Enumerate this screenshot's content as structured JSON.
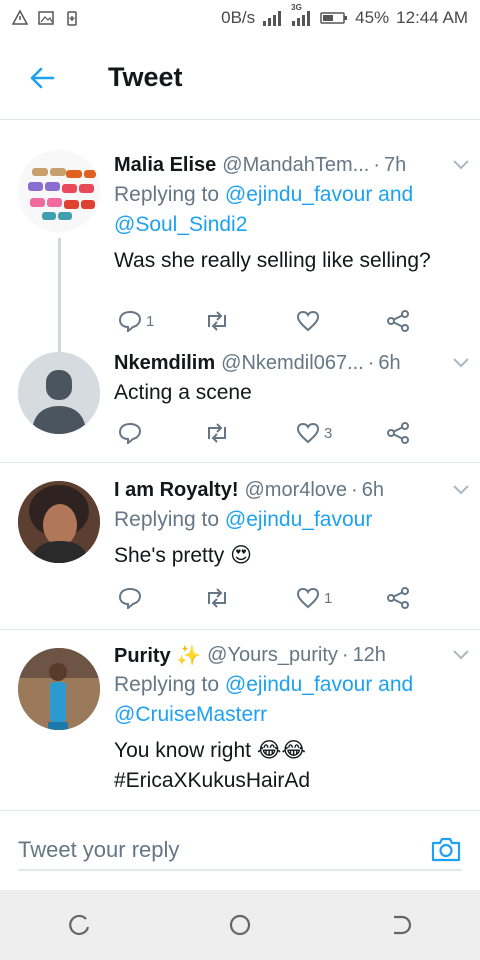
{
  "status_bar": {
    "network_speed": "0B/s",
    "network_type": "3G",
    "battery": "45%",
    "time": "12:44 AM"
  },
  "header": {
    "title": "Tweet",
    "back_icon": "arrow-left-icon"
  },
  "tweets": [
    {
      "name": "Malia Elise",
      "handle": "@MandahTem...",
      "time": "7h",
      "replying_prefix": "Replying to",
      "reply_to_1": "@ejindu_favour",
      "reply_joiner": "and",
      "reply_to_2": "@Soul_Sindi2",
      "text": "Was she really selling like selling?",
      "reply_count": "1",
      "like_count": ""
    },
    {
      "name": "Nkemdilim",
      "handle": "@Nkemdil067...",
      "time": "6h",
      "text": "Acting a scene",
      "reply_count": "",
      "like_count": "3"
    },
    {
      "name": "I am Royalty!",
      "handle": "@mor4love",
      "time": "6h",
      "replying_prefix": "Replying to",
      "reply_to_1": "@ejindu_favour",
      "text": "She's pretty 😍",
      "reply_count": "",
      "like_count": "1"
    },
    {
      "name": "Purity ✨",
      "handle": "@Yours_purity",
      "time": "12h",
      "replying_prefix": "Replying to",
      "reply_to_1": "@ejindu_favour",
      "reply_joiner": "and",
      "reply_to_2": "@CruiseMasterr",
      "text": "You know right 😂😂",
      "hashtag": "#EricaXKukusHairAd"
    }
  ],
  "reply_bar": {
    "placeholder": "Tweet your reply",
    "camera_icon": "camera-icon"
  },
  "colors": {
    "accent": "#1da1f2",
    "text": "#14171a",
    "muted": "#657786",
    "divider": "#e1e8ed"
  }
}
